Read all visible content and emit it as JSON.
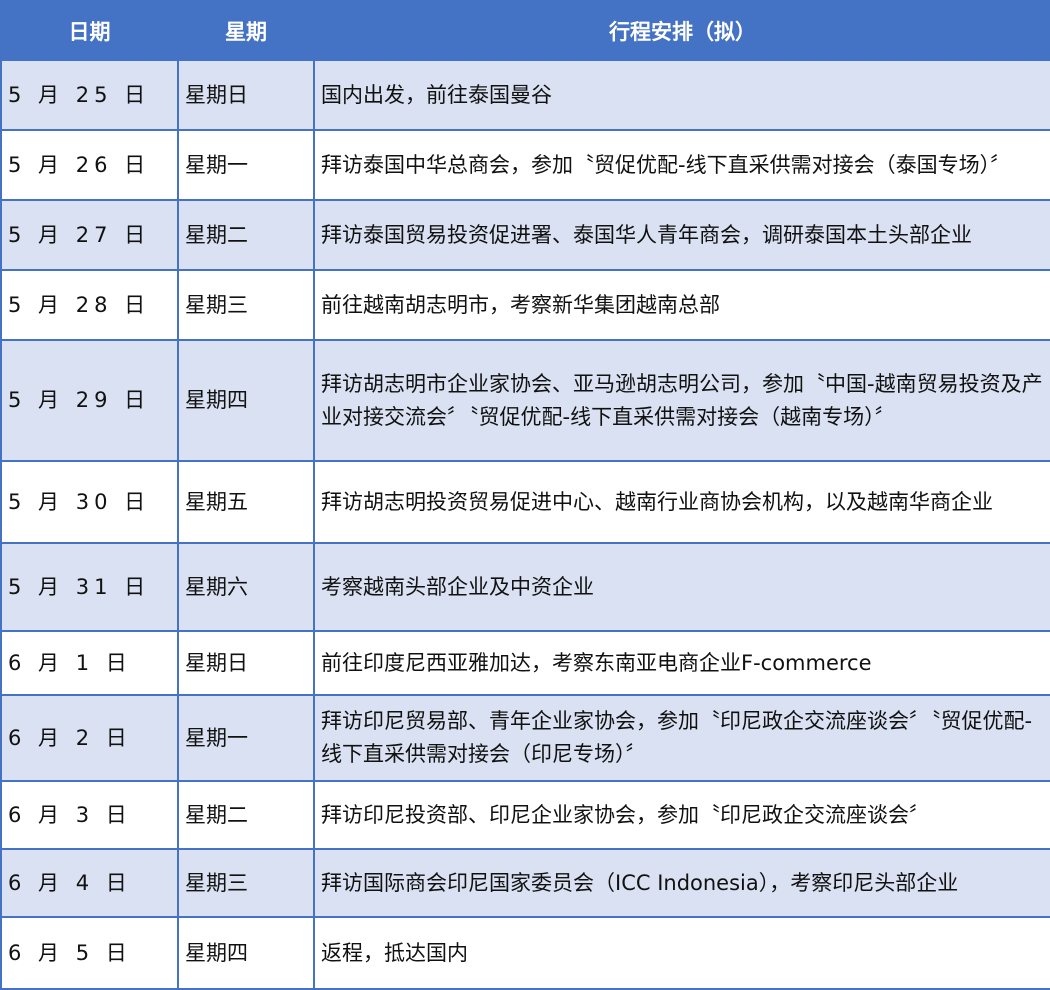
{
  "headers": [
    "日期",
    "星期",
    "行程安排（拟）"
  ],
  "colors": {
    "header_bg": "#4472c4",
    "shaded_row": "#d9e1f2",
    "border": "#4472c4"
  },
  "rows": [
    {
      "date": "5 月 25 日",
      "weekday": "星期日",
      "plan": "国内出发，前往泰国曼谷"
    },
    {
      "date": "5 月 26 日",
      "weekday": "星期一",
      "plan": "拜访泰国中华总商会，参加〝贸促优配-线下直采供需对接会（泰国专场）〞"
    },
    {
      "date": "5 月 27 日",
      "weekday": "星期二",
      "plan": "拜访泰国贸易投资促进署、泰国华人青年商会，调研泰国本土头部企业"
    },
    {
      "date": "5 月 28 日",
      "weekday": "星期三",
      "plan": "前往越南胡志明市，考察新华集团越南总部"
    },
    {
      "date": "5 月 29 日",
      "weekday": "星期四",
      "plan": "拜访胡志明市企业家协会、亚马逊胡志明公司，参加〝中国-越南贸易投资及产业对接交流会〞〝贸促优配-线下直采供需对接会（越南专场）〞"
    },
    {
      "date": "5 月 30 日",
      "weekday": "星期五",
      "plan": "拜访胡志明投资贸易促进中心、越南行业商协会机构，以及越南华商企业"
    },
    {
      "date": "5 月 31 日",
      "weekday": "星期六",
      "plan": "考察越南头部企业及中资企业"
    },
    {
      "date": "6 月 1 日",
      "weekday": "星期日",
      "plan": "前往印度尼西亚雅加达，考察东南亚电商企业F-commerce"
    },
    {
      "date": "6 月 2 日",
      "weekday": "星期一",
      "plan": "拜访印尼贸易部、青年企业家协会，参加〝印尼政企交流座谈会〞〝贸促优配-线下直采供需对接会（印尼专场）〞"
    },
    {
      "date": "6 月 3 日",
      "weekday": "星期二",
      "plan": "拜访印尼投资部、印尼企业家协会，参加〝印尼政企交流座谈会〞"
    },
    {
      "date": "6 月 4 日",
      "weekday": "星期三",
      "plan": "拜访国际商会印尼国家委员会（ICC Indonesia），考察印尼头部企业"
    },
    {
      "date": "6 月 5 日",
      "weekday": "星期四",
      "plan": "返程，抵达国内"
    }
  ]
}
